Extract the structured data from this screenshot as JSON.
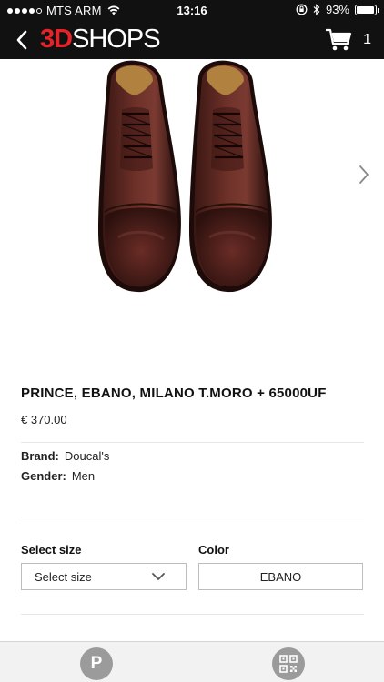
{
  "status_bar": {
    "carrier": "MTS ARM",
    "time": "13:16",
    "battery": "93%",
    "battery_level": 0.93,
    "icons": [
      "signal-icon",
      "wifi-icon",
      "rotation-lock-icon",
      "bluetooth-icon",
      "battery-icon"
    ]
  },
  "header": {
    "logo_accent": "3D",
    "logo_main": "SHOPS",
    "cart_count": "1",
    "icons": [
      "back-chevron-icon",
      "cart-icon"
    ],
    "colors": {
      "background": "#111111",
      "logo_accent": "#e4232b"
    }
  },
  "gallery": {
    "image": "brown-leather-oxford-shoes",
    "icons": [
      "chevron-right-icon"
    ]
  },
  "product": {
    "title": "PRINCE, EBANO, MILANO T.MORO + 65000UF",
    "price": "€ 370.00",
    "brand_label": "Brand:",
    "brand_value": "Doucal's",
    "gender_label": "Gender:",
    "gender_value": "Men"
  },
  "options": {
    "size_label": "Select size",
    "size_value": "Select size",
    "color_label": "Color",
    "color_value": "EBANO"
  },
  "tab_bar": {
    "p_label": "P",
    "icons": [
      "p-badge-icon",
      "qr-code-icon"
    ]
  }
}
